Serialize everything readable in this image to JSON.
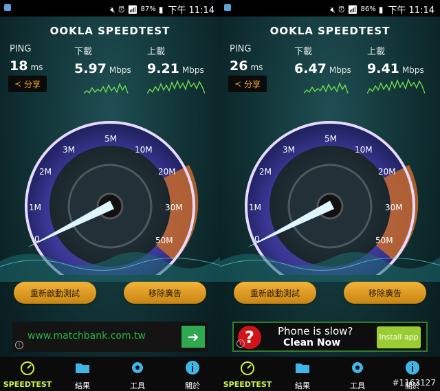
{
  "screens": [
    {
      "status": {
        "battery": "87%",
        "time": "下午 11:14"
      },
      "logo": "OOKLA SPEEDTEST",
      "ping": {
        "label": "PING",
        "value": "18",
        "unit": "ms"
      },
      "download": {
        "label": "下載",
        "value": "5.97",
        "unit": "Mbps"
      },
      "upload": {
        "label": "上載",
        "value": "9.21",
        "unit": "Mbps"
      },
      "share_label": "分享",
      "gauge": {
        "scale": [
          "0",
          "1M",
          "2M",
          "3M",
          "5M",
          "10M",
          "20M",
          "30M",
          "50M"
        ],
        "needle_value_mbps": 0.3
      },
      "buttons": {
        "restart": "重新啟動測試",
        "remove_ads": "移除廣告"
      },
      "ad": {
        "type": "url",
        "text": "www.matchbank.com.tw"
      },
      "tabs": [
        "SPEEDTEST",
        "結果",
        "工具",
        "關於"
      ]
    },
    {
      "status": {
        "battery": "86%",
        "time": "下午 11:14"
      },
      "logo": "OOKLA SPEEDTEST",
      "ping": {
        "label": "PING",
        "value": "26",
        "unit": "ms"
      },
      "download": {
        "label": "下載",
        "value": "6.47",
        "unit": "Mbps"
      },
      "upload": {
        "label": "上載",
        "value": "9.41",
        "unit": "Mbps"
      },
      "share_label": "分享",
      "gauge": {
        "scale": [
          "0",
          "1M",
          "2M",
          "3M",
          "5M",
          "10M",
          "20M",
          "30M",
          "50M"
        ],
        "needle_value_mbps": 0.3
      },
      "buttons": {
        "restart": "重新啟動測試",
        "remove_ads": "移除廣告"
      },
      "ad": {
        "type": "app",
        "line1": "Phone is slow?",
        "line2": "Clean Now",
        "install": "Install app"
      },
      "tabs": [
        "SPEEDTEST",
        "結果",
        "工具",
        "關於"
      ]
    }
  ],
  "colors": {
    "accent_orange": "#f2b33a",
    "speedtest_green": "#c9f24a",
    "tab_icon_blue": "#3fb6e6",
    "gauge_glow": "#b46bff"
  },
  "watermark": "#1163127"
}
